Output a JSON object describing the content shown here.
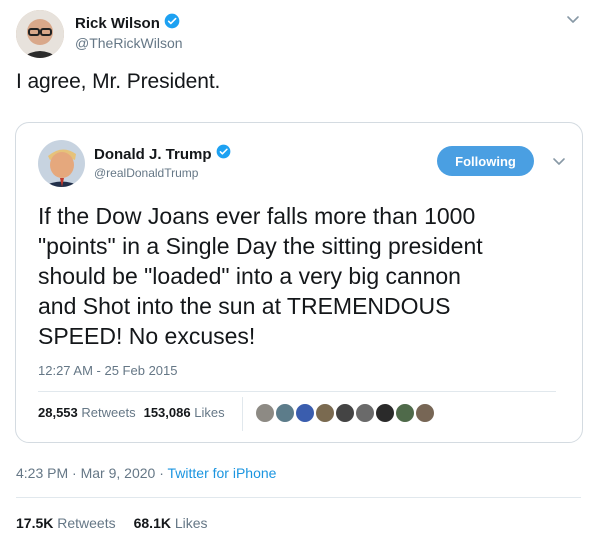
{
  "author": {
    "name": "Rick Wilson",
    "handle": "@TheRickWilson",
    "verified_icon": "verified-badge-icon",
    "avatar_color": "#c9a98d"
  },
  "tweet": {
    "text": "I agree, Mr. President."
  },
  "quoted": {
    "name": "Donald J. Trump",
    "handle": "@realDonaldTrump",
    "follow_label": "Following",
    "text_lines": [
      "If the Dow Joans ever falls more than 1000",
      "\"points\" in a Single Day the sitting president",
      "should be \"loaded\" into a very big cannon",
      "and Shot into the sun at TREMENDOUS",
      "SPEED! No excuses!"
    ],
    "timestamp": "12:27 AM - 25 Feb 2015",
    "retweets_count": "28,553",
    "retweets_label": "Retweets",
    "likes_count": "153,086",
    "likes_label": "Likes",
    "liker_colors": [
      "#8d8a84",
      "#5c7c8a",
      "#3a5dae",
      "#7a6a50",
      "#444444",
      "#6a6a6a",
      "#2a2a2a",
      "#4f6a4a",
      "#776655"
    ]
  },
  "meta": {
    "time": "4:23 PM",
    "sep1": "·",
    "date": "Mar 9, 2020",
    "sep2": "·",
    "source": "Twitter for iPhone"
  },
  "stats": {
    "retweets_count": "17.5K",
    "retweets_label": "Retweets",
    "likes_count": "68.1K",
    "likes_label": "Likes"
  },
  "colors": {
    "accent": "#1da1f2",
    "follow_button": "#4a9fe2",
    "muted": "#657786",
    "border": "#d4dbe1"
  }
}
